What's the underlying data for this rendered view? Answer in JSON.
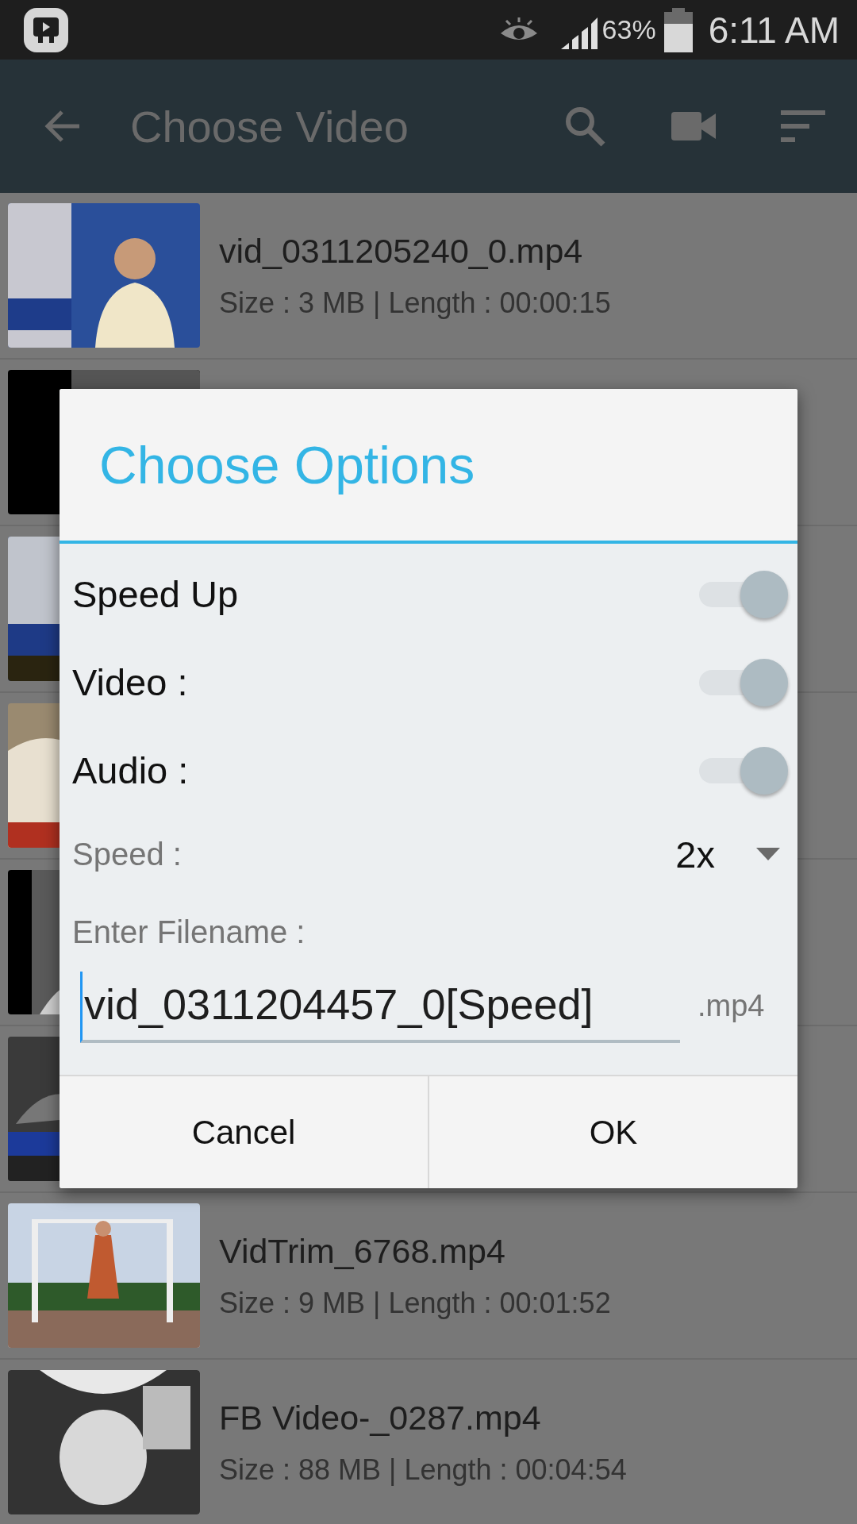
{
  "status_bar": {
    "battery_percent": "63%",
    "time": "6:11 AM"
  },
  "app_bar": {
    "title": "Choose Video"
  },
  "videos": [
    {
      "kind": "video",
      "name": "vid_0311205240_0.mp4",
      "details": "Size : 3 MB | Length : 00:00:15"
    },
    {
      "kind": "covered"
    },
    {
      "kind": "covered"
    },
    {
      "kind": "covered"
    },
    {
      "kind": "covered"
    },
    {
      "kind": "covered"
    },
    {
      "kind": "video",
      "name": "VidTrim_6768.mp4",
      "details": "Size : 9 MB | Length : 00:01:52"
    },
    {
      "kind": "video",
      "name": "FB Video-_0287.mp4",
      "details": "Size : 88 MB | Length : 00:04:54"
    }
  ],
  "dialog": {
    "title": "Choose Options",
    "switches": [
      {
        "label": "Speed Up",
        "on": true
      },
      {
        "label": "Video :",
        "on": true
      },
      {
        "label": "Audio :",
        "on": true
      }
    ],
    "speed": {
      "label": "Speed :",
      "value": "2x"
    },
    "filename": {
      "label": "Enter Filename :",
      "value": "vid_0311204457_0[Speed]",
      "extension": ".mp4"
    },
    "buttons": [
      "Cancel",
      "OK"
    ]
  }
}
